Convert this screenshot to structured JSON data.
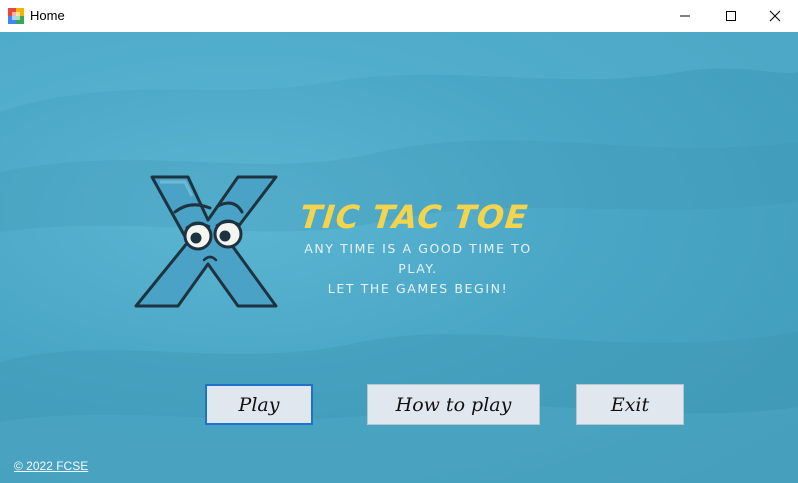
{
  "window": {
    "title": "Home",
    "icons": {
      "app": "app-icon",
      "minimize": "minimize-icon",
      "maximize": "maximize-icon",
      "close": "close-icon"
    }
  },
  "hero": {
    "title": "TIC TAC TOE",
    "tagline_line1": "ANY TIME IS A GOOD TIME TO PLAY.",
    "tagline_line2": "LET THE GAMES BEGIN!",
    "logo": "x-character-logo"
  },
  "menu": {
    "play_label": "Play",
    "how_to_play_label": "How to play",
    "exit_label": "Exit"
  },
  "footer": {
    "copyright": "© 2022 FCSE"
  },
  "colors": {
    "background": "#4aa6c5",
    "title": "#f5d44d",
    "button_bg": "#e1e7ef",
    "focus_border": "#1e72c9"
  }
}
